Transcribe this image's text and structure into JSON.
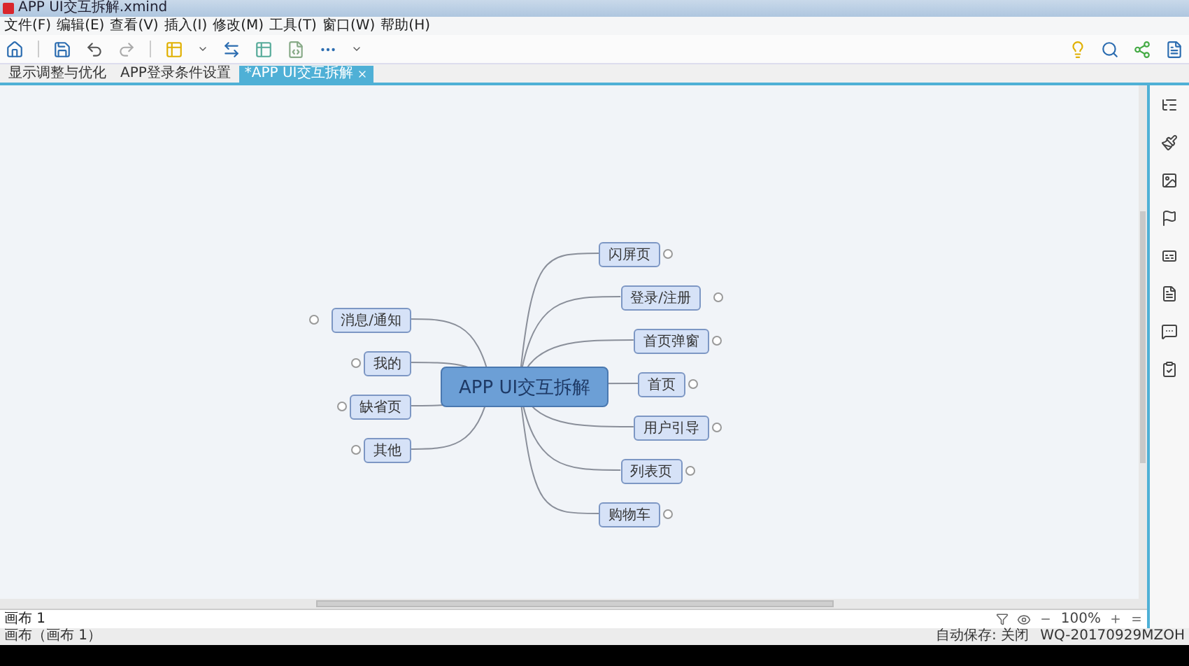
{
  "window": {
    "title": "APP UI交互拆解.xmind"
  },
  "menu": [
    "文件(F)",
    "编辑(E)",
    "查看(V)",
    "插入(I)",
    "修改(M)",
    "工具(T)",
    "窗口(W)",
    "帮助(H)"
  ],
  "tabs": [
    {
      "label": "显示调整与优化",
      "selected": false
    },
    {
      "label": "APP登录条件设置",
      "selected": false
    },
    {
      "label": "*APP UI交互拆解",
      "selected": true
    }
  ],
  "mindmap": {
    "central": "APP UI交互拆解",
    "right": [
      "闪屏页",
      "登录/注册",
      "首页弹窗",
      "首页",
      "用户引导",
      "列表页",
      "购物车"
    ],
    "left": [
      "消息/通知",
      "我的",
      "缺省页",
      "其他"
    ]
  },
  "sheet_tab": "画布 1",
  "zoom": "100%",
  "status_bar": {
    "left": "画布（画布 1）",
    "autosave": "自动保存: 关闭",
    "user": "WQ-20170929MZOH"
  }
}
